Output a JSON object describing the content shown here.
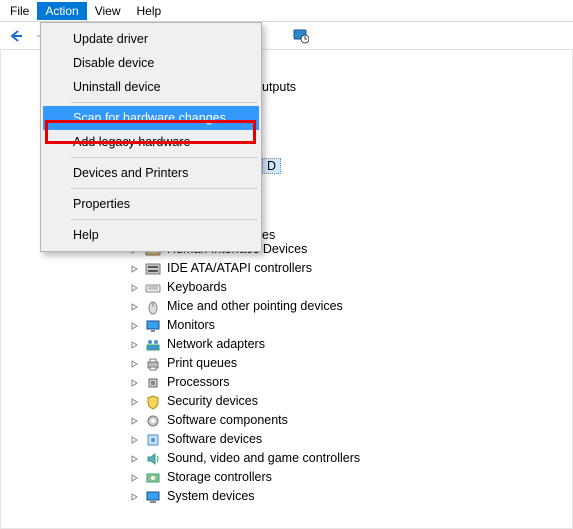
{
  "menubar": {
    "items": [
      "File",
      "Action",
      "View",
      "Help"
    ],
    "open_index": 1
  },
  "toolbar": {
    "back_icon": "nav-back",
    "fwd_icon": "nav-forward",
    "refresh_icon": "monitor-refresh"
  },
  "dropdown": {
    "items": [
      {
        "label": "Update driver",
        "type": "item"
      },
      {
        "label": "Disable device",
        "type": "item"
      },
      {
        "label": "Uninstall device",
        "type": "item"
      },
      {
        "type": "sep"
      },
      {
        "label": "Scan for hardware changes",
        "type": "item",
        "highlighted": true
      },
      {
        "label": "Add legacy hardware",
        "type": "item"
      },
      {
        "type": "sep"
      },
      {
        "label": "Devices and Printers",
        "type": "item"
      },
      {
        "type": "sep"
      },
      {
        "label": "Properties",
        "type": "item"
      },
      {
        "type": "sep"
      },
      {
        "label": "Help",
        "type": "item"
      }
    ]
  },
  "peek1": "utputs",
  "peek2": "D",
  "peek3": "es",
  "tree": {
    "items": [
      {
        "label": "Human Interface Devices",
        "icon": "hid"
      },
      {
        "label": "IDE ATA/ATAPI controllers",
        "icon": "ide"
      },
      {
        "label": "Keyboards",
        "icon": "keyboard"
      },
      {
        "label": "Mice and other pointing devices",
        "icon": "mouse"
      },
      {
        "label": "Monitors",
        "icon": "monitor"
      },
      {
        "label": "Network adapters",
        "icon": "network"
      },
      {
        "label": "Print queues",
        "icon": "printer"
      },
      {
        "label": "Processors",
        "icon": "cpu"
      },
      {
        "label": "Security devices",
        "icon": "security"
      },
      {
        "label": "Software components",
        "icon": "software"
      },
      {
        "label": "Software devices",
        "icon": "software"
      },
      {
        "label": "Sound, video and game controllers",
        "icon": "sound"
      },
      {
        "label": "Storage controllers",
        "icon": "storage"
      },
      {
        "label": "System devices",
        "icon": "system"
      }
    ]
  }
}
